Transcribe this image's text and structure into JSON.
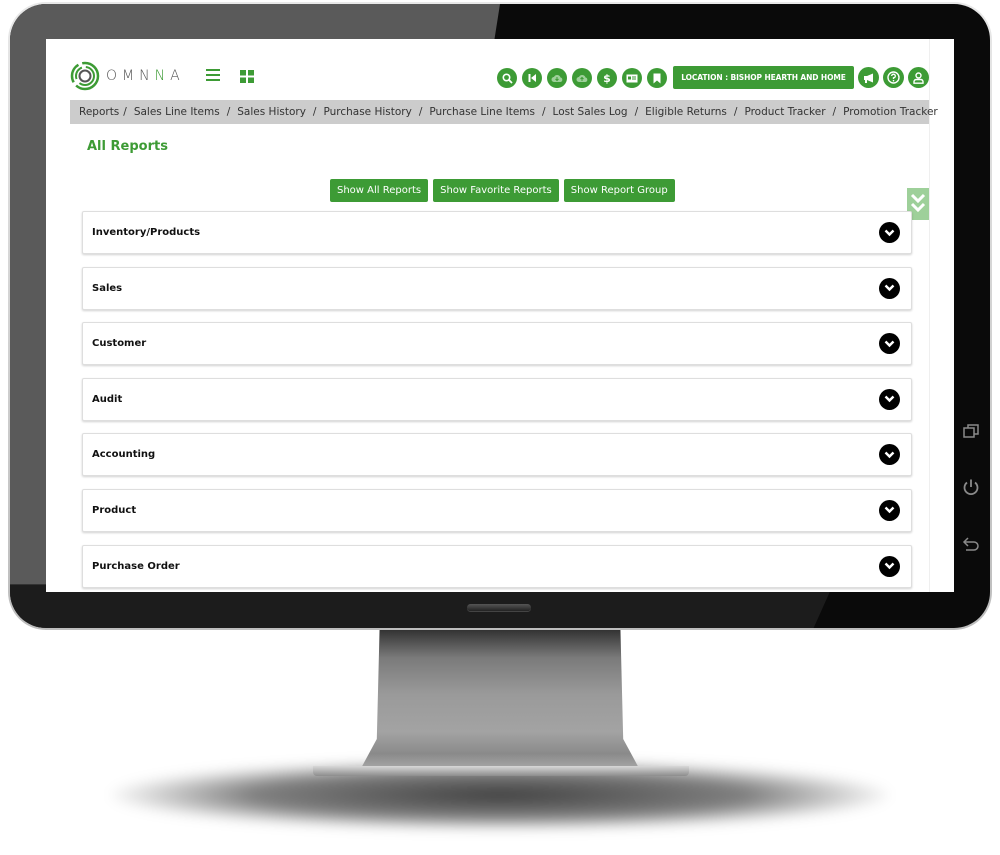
{
  "app": {
    "brand_prefix": "OMN",
    "brand_accent": "N",
    "brand_suffix": "A",
    "accent_color": "#3d9b35"
  },
  "header": {
    "icons": [
      {
        "name": "search-icon",
        "glyph": "⚲"
      },
      {
        "name": "skip-back-icon",
        "glyph": "K"
      },
      {
        "name": "cloud-download-icon",
        "glyph": "☁"
      },
      {
        "name": "cloud-upload-icon",
        "glyph": "☁"
      },
      {
        "name": "dollar-icon",
        "glyph": "$"
      },
      {
        "name": "id-card-icon",
        "glyph": "▤"
      },
      {
        "name": "bookmark-icon",
        "glyph": "▮"
      }
    ],
    "location_label": "LOCATION : BISHOP HEARTH AND HOME",
    "right_icons": [
      {
        "name": "megaphone-icon",
        "glyph": "📢"
      },
      {
        "name": "help-icon",
        "glyph": "?"
      },
      {
        "name": "user-icon",
        "glyph": "👤"
      }
    ]
  },
  "breadcrumb": {
    "items": [
      "Reports",
      "Sales Line Items",
      "Sales History",
      "Purchase History",
      "Purchase Line Items",
      "Lost Sales Log",
      "Eligible Returns",
      "Product Tracker",
      "Promotion Tracker"
    ],
    "separator": "/"
  },
  "page": {
    "title": "All Reports",
    "buttons": {
      "show_all": "Show All Reports",
      "show_favorite": "Show Favorite Reports",
      "show_group": "Show Report Group"
    }
  },
  "report_groups": [
    {
      "label": "Inventory/Products"
    },
    {
      "label": "Sales"
    },
    {
      "label": "Customer"
    },
    {
      "label": "Audit"
    },
    {
      "label": "Accounting"
    },
    {
      "label": "Product"
    },
    {
      "label": "Purchase Order"
    }
  ],
  "device": {
    "side_buttons": [
      "recent-apps-icon",
      "power-icon",
      "back-icon"
    ]
  }
}
